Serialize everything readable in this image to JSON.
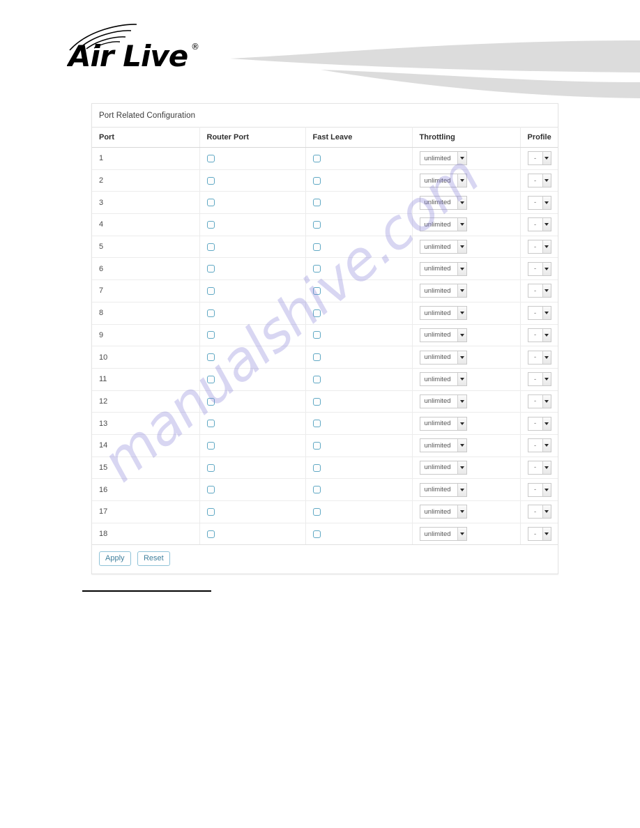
{
  "brand": {
    "name": "Air Live",
    "registered_mark": "®",
    "logo_icon": "airlive-wifi-logo"
  },
  "panel": {
    "title": "Port Related Configuration"
  },
  "table": {
    "columns": [
      "Port",
      "Router Port",
      "Fast Leave",
      "Throttling",
      "Profile"
    ],
    "rows": [
      {
        "port": "1",
        "router_port_checked": false,
        "fast_leave_checked": false,
        "throttling": "unlimited",
        "profile": "-"
      },
      {
        "port": "2",
        "router_port_checked": false,
        "fast_leave_checked": false,
        "throttling": "unlimited",
        "profile": "-"
      },
      {
        "port": "3",
        "router_port_checked": false,
        "fast_leave_checked": false,
        "throttling": "unlimited",
        "profile": "-"
      },
      {
        "port": "4",
        "router_port_checked": false,
        "fast_leave_checked": false,
        "throttling": "unlimited",
        "profile": "-"
      },
      {
        "port": "5",
        "router_port_checked": false,
        "fast_leave_checked": false,
        "throttling": "unlimited",
        "profile": "-"
      },
      {
        "port": "6",
        "router_port_checked": false,
        "fast_leave_checked": false,
        "throttling": "unlimited",
        "profile": "-"
      },
      {
        "port": "7",
        "router_port_checked": false,
        "fast_leave_checked": false,
        "throttling": "unlimited",
        "profile": "-"
      },
      {
        "port": "8",
        "router_port_checked": false,
        "fast_leave_checked": false,
        "throttling": "unlimited",
        "profile": "-"
      },
      {
        "port": "9",
        "router_port_checked": false,
        "fast_leave_checked": false,
        "throttling": "unlimited",
        "profile": "-"
      },
      {
        "port": "10",
        "router_port_checked": false,
        "fast_leave_checked": false,
        "throttling": "unlimited",
        "profile": "-"
      },
      {
        "port": "11",
        "router_port_checked": false,
        "fast_leave_checked": false,
        "throttling": "unlimited",
        "profile": "-"
      },
      {
        "port": "12",
        "router_port_checked": false,
        "fast_leave_checked": false,
        "throttling": "unlimited",
        "profile": "-"
      },
      {
        "port": "13",
        "router_port_checked": false,
        "fast_leave_checked": false,
        "throttling": "unlimited",
        "profile": "-"
      },
      {
        "port": "14",
        "router_port_checked": false,
        "fast_leave_checked": false,
        "throttling": "unlimited",
        "profile": "-"
      },
      {
        "port": "15",
        "router_port_checked": false,
        "fast_leave_checked": false,
        "throttling": "unlimited",
        "profile": "-"
      },
      {
        "port": "16",
        "router_port_checked": false,
        "fast_leave_checked": false,
        "throttling": "unlimited",
        "profile": "-"
      },
      {
        "port": "17",
        "router_port_checked": false,
        "fast_leave_checked": false,
        "throttling": "unlimited",
        "profile": "-"
      },
      {
        "port": "18",
        "router_port_checked": false,
        "fast_leave_checked": false,
        "throttling": "unlimited",
        "profile": "-"
      }
    ]
  },
  "buttons": {
    "apply": "Apply",
    "reset": "Reset"
  },
  "watermark": {
    "text": "manualshive.com"
  },
  "colors": {
    "checkbox_border": "#5fa8c4",
    "button_border": "#8fc3d8",
    "button_text": "#3f7f9c",
    "panel_border": "#e4e4e4",
    "swoosh": "#dcdcdc",
    "watermark": "#7e78d4",
    "rule": "#000000"
  }
}
